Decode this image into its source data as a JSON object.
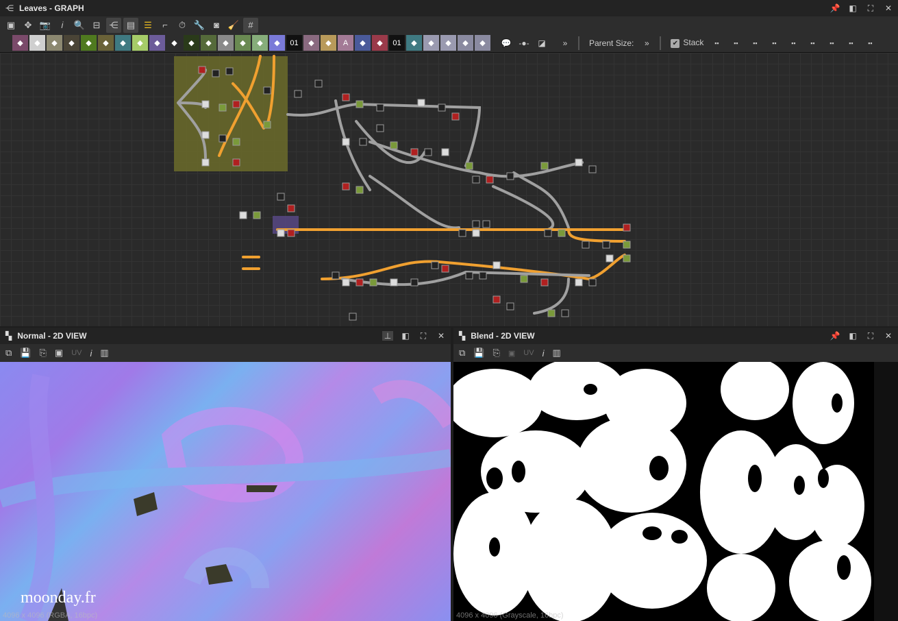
{
  "graph_panel": {
    "title": "Leaves - GRAPH",
    "window_buttons": [
      "pin-icon",
      "float-icon",
      "maximize-icon",
      "close-icon"
    ]
  },
  "toolbar1": [
    "fit-icon",
    "zoom-1to1-icon",
    "camera-icon",
    "info-icon",
    "search-icon",
    "node-align-icon",
    "graph-icon",
    "frame-icon",
    "list-icon",
    "connect-icon",
    "timer-icon",
    "wrench-icon",
    "preview-icon",
    "clean-icon",
    "grid-snap-icon"
  ],
  "toolbar2": {
    "nodes": [
      {
        "icon": "bitmap-icon",
        "color": "#7a4a6a"
      },
      {
        "icon": "svg-icon",
        "color": "#cfcfcf"
      },
      {
        "icon": "uniform-color-icon",
        "color": "#8c8870"
      },
      {
        "icon": "shuffle-icon",
        "color": "#4a4436"
      },
      {
        "icon": "curve-icon",
        "color": "#4f7a1f"
      },
      {
        "icon": "levels-icon",
        "color": "#6a6238"
      },
      {
        "icon": "warp-icon",
        "color": "#3f7a82"
      },
      {
        "icon": "gradient-icon",
        "color": "#a6cc68"
      },
      {
        "icon": "shape-icon",
        "color": "#6c5c9a"
      },
      {
        "icon": "tile-icon",
        "color": "#2d2d2d"
      },
      {
        "icon": "blend-icon",
        "color": "#2a3a1a"
      },
      {
        "icon": "blend-alt-icon",
        "color": "#556a3a"
      },
      {
        "icon": "switch-icon",
        "color": "#8a8a8a"
      },
      {
        "icon": "transform-icon",
        "color": "#6a8a52"
      },
      {
        "icon": "histogram-icon",
        "color": "#86ad7a"
      },
      {
        "icon": "hsl-icon",
        "color": "#7a7ad8"
      },
      {
        "icon": "value-icon",
        "color": "#111111",
        "text": "01"
      },
      {
        "icon": "spline-icon",
        "color": "#8a6a80"
      },
      {
        "icon": "mirror-icon",
        "color": "#b89a5a"
      },
      {
        "icon": "text-icon",
        "color": "#a37a96",
        "text": "A"
      },
      {
        "icon": "crop-icon",
        "color": "#4a5a9a"
      },
      {
        "icon": "fill-icon",
        "color": "#9a3a4a"
      },
      {
        "icon": "fx-value-icon",
        "color": "#111111",
        "text": "01"
      },
      {
        "icon": "pattern-icon",
        "color": "#3f7a82"
      },
      {
        "icon": "input-icon",
        "color": "#9a9ab0"
      },
      {
        "icon": "output-icon",
        "color": "#9a9ab0"
      },
      {
        "icon": "pixel-processor-icon",
        "color": "#8a8aa0"
      },
      {
        "icon": "frame-node-icon",
        "color": "#8a8aa0"
      }
    ],
    "extra": [
      "comment-icon",
      "dot-icon",
      "graph-link-icon"
    ],
    "overflow": "»",
    "parent_size_label": "Parent Size:",
    "stack_label": "Stack",
    "stack_checked": true,
    "align_icons": [
      "align-left-icon",
      "align-center-icon",
      "align-right-icon",
      "align-top-icon",
      "align-middle-icon",
      "align-bottom-icon",
      "distribute-h-icon",
      "distribute-v-icon",
      "snap-icon"
    ]
  },
  "normal_panel": {
    "title": "Normal - 2D VIEW",
    "uv_label": "UV",
    "status": "4096 x 4096 (RGBA, 16bpc)",
    "watermark": "moonday.fr"
  },
  "blend_panel": {
    "title": "Blend - 2D VIEW",
    "uv_label": "UV",
    "status": "4096 x 4096 (Grayscale, 16bpc)"
  },
  "colors": {
    "frame": "#6b6b2a",
    "wire_orange": "#f0a030",
    "wire_gray": "#a0a0a0"
  }
}
